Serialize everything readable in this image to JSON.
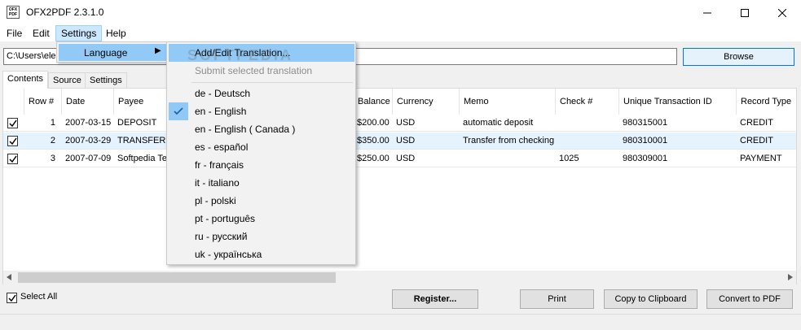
{
  "app": {
    "title": "OFX2PDF 2.3.1.0",
    "icon_text": "OFX\nPDF"
  },
  "menubar": {
    "file": "File",
    "edit": "Edit",
    "settings": "Settings",
    "help": "Help"
  },
  "path": {
    "value": "C:\\Users\\ele",
    "browse_label": "Browse"
  },
  "tabs": [
    {
      "label": "Contents",
      "active": true
    },
    {
      "label": "Source",
      "active": false
    },
    {
      "label": "Settings",
      "active": false
    }
  ],
  "grid": {
    "columns": [
      "Row #",
      "Date",
      "Payee",
      "Balance",
      "Currency",
      "Memo",
      "Check #",
      "Unique Transaction ID",
      "Record Type"
    ],
    "rows": [
      {
        "checked": true,
        "row": "1",
        "date": "2007-03-15",
        "payee": "DEPOSIT",
        "balance": "$200.00",
        "currency": "USD",
        "memo": "automatic deposit",
        "check": "",
        "uid": "980315001",
        "type": "CREDIT",
        "selected": false
      },
      {
        "checked": true,
        "row": "2",
        "date": "2007-03-29",
        "payee": "TRANSFER",
        "balance": "$350.00",
        "currency": "USD",
        "memo": "Transfer from checking",
        "check": "",
        "uid": "980310001",
        "type": "CREDIT",
        "selected": true
      },
      {
        "checked": true,
        "row": "3",
        "date": "2007-07-09",
        "payee": "Softpedia Te",
        "balance": "$250.00",
        "currency": "USD",
        "memo": "",
        "check": "1025",
        "uid": "980309001",
        "type": "PAYMENT",
        "selected": false
      }
    ]
  },
  "bottom": {
    "select_all": "Select All",
    "register": "Register...",
    "print": "Print",
    "copy": "Copy to Clipboard",
    "convert": "Convert to PDF"
  },
  "settings_menu": {
    "language": "Language"
  },
  "language_menu": {
    "add_edit": "Add/Edit Translation...",
    "submit": "Submit selected translation",
    "languages": [
      {
        "label": "de - Deutsch",
        "checked": false
      },
      {
        "label": "en - English",
        "checked": true
      },
      {
        "label": "en - English ( Canada )",
        "checked": false
      },
      {
        "label": "es - español",
        "checked": false
      },
      {
        "label": "fr - français",
        "checked": false
      },
      {
        "label": "it - italiano",
        "checked": false
      },
      {
        "label": "pl - polski",
        "checked": false
      },
      {
        "label": "pt - português",
        "checked": false
      },
      {
        "label": "ru - русский",
        "checked": false
      },
      {
        "label": "uk - українська",
        "checked": false
      }
    ]
  },
  "watermark": "SOFTPEDIA",
  "colors": {
    "accent": "#0078d7",
    "menu_highlight": "#91c9f7",
    "row_selected": "#e5f3ff"
  }
}
